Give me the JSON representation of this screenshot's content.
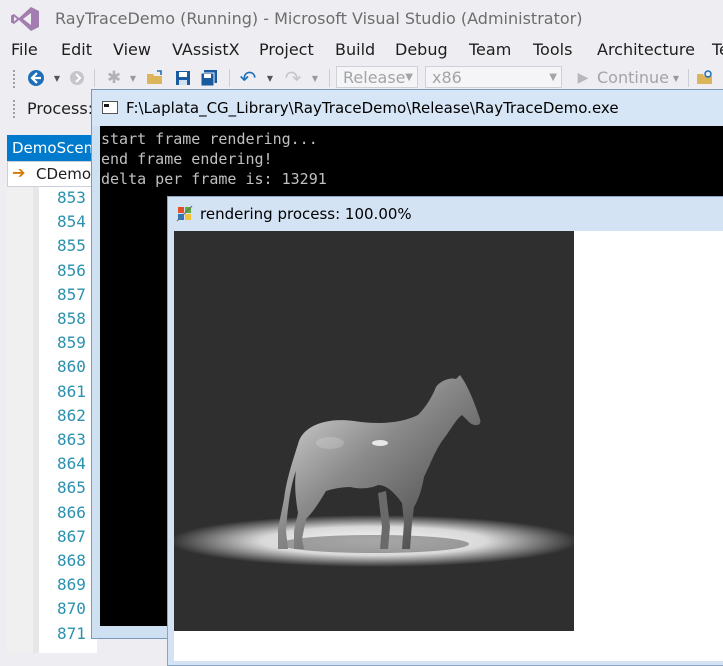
{
  "vs": {
    "title": "RayTraceDemo (Running) - Microsoft Visual Studio (Administrator)",
    "menu": [
      "File",
      "Edit",
      "View",
      "VAssistX",
      "Project",
      "Build",
      "Debug",
      "Team",
      "Tools",
      "Architecture",
      "Te"
    ],
    "toolbar": {
      "config": "Release",
      "platform": "x86",
      "continue_label": "Continue"
    },
    "process_label": "Process:",
    "doc_tab": "DemoScene",
    "nav_label": "CDemo",
    "line_numbers": [
      "853",
      "854",
      "855",
      "856",
      "857",
      "858",
      "859",
      "860",
      "861",
      "862",
      "863",
      "864",
      "865",
      "866",
      "867",
      "868",
      "869",
      "870",
      "871"
    ]
  },
  "console": {
    "title": "F:\\Laplata_CG_Library\\RayTraceDemo\\Release\\RayTraceDemo.exe",
    "lines": [
      "start frame rendering...",
      "end frame endering!",
      "delta per frame is: 13291"
    ]
  },
  "render": {
    "title": "rendering process: 100.00%",
    "image_subject": "horse-render"
  },
  "colors": {
    "accent": "#007acc",
    "line_number": "#2b91af",
    "console_bg": "#000000",
    "console_text": "#c0c0c0"
  }
}
